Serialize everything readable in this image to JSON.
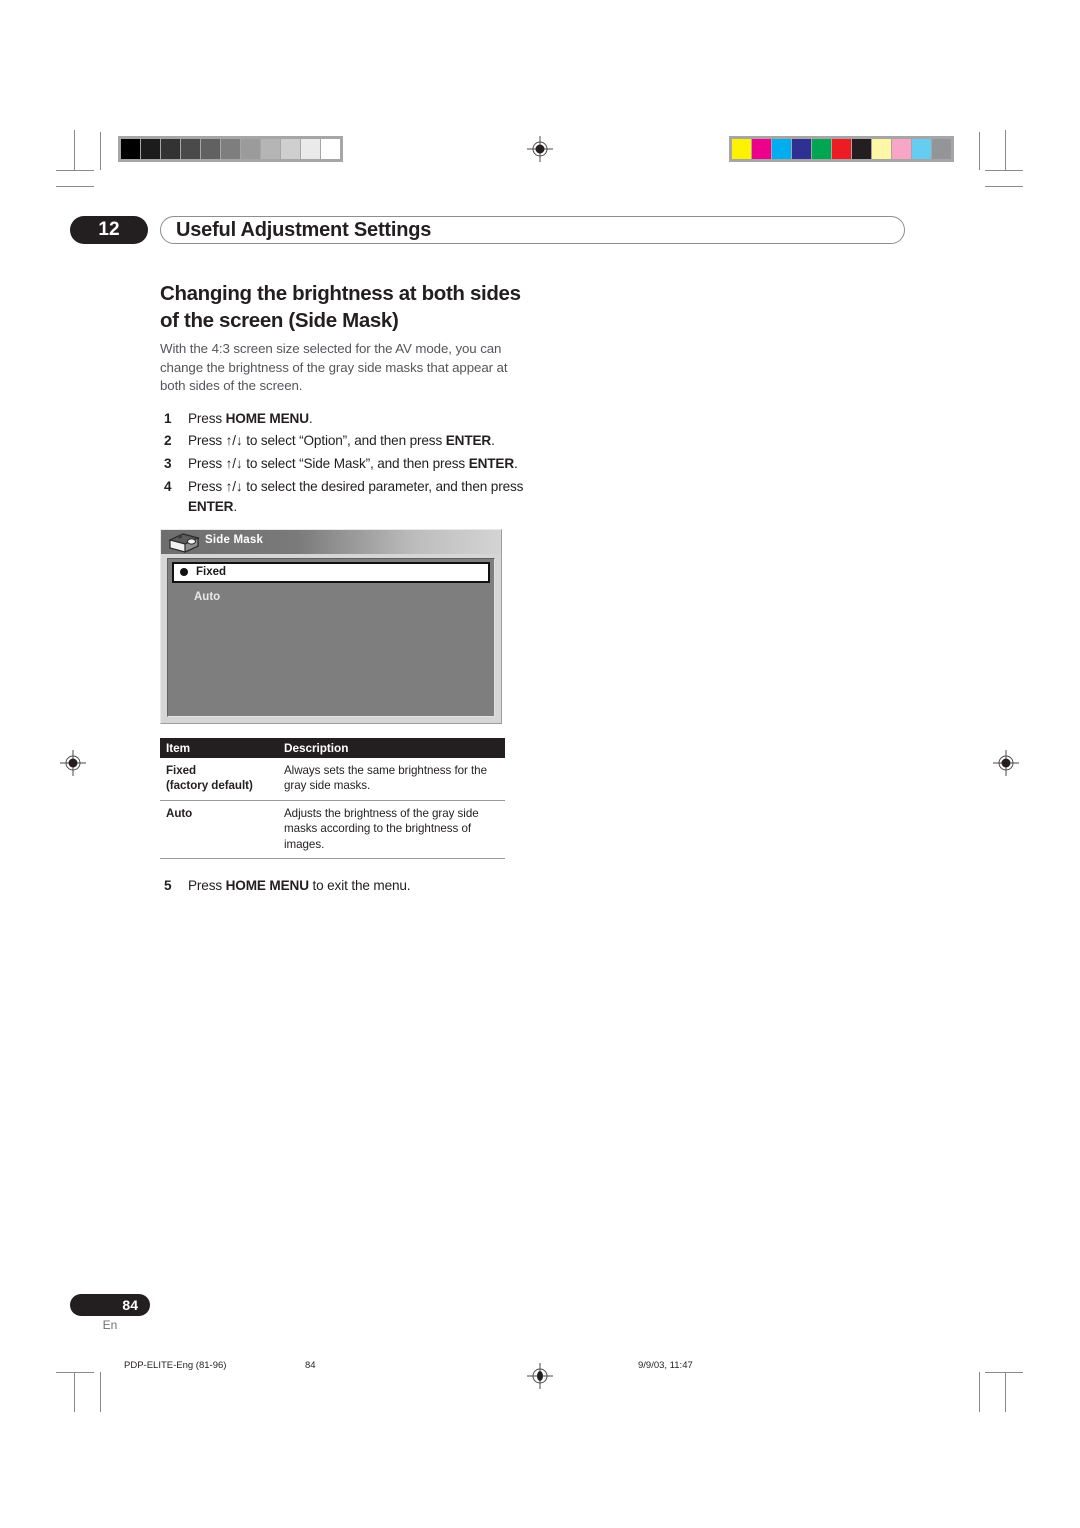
{
  "document": {
    "chapter_number": "12",
    "chapter_title": "Useful Adjustment Settings",
    "page_number": "84",
    "language_code": "En"
  },
  "section": {
    "title": "Changing the brightness at both sides of the screen (Side Mask)",
    "intro": "With the 4:3 screen size selected for the AV mode, you can change the brightness of the gray side masks that appear at both sides of the screen."
  },
  "steps": [
    {
      "num": "1",
      "text_html": "Press <b>HOME MENU</b>."
    },
    {
      "num": "2",
      "text_html": "Press <b>↑</b>/<b>↓</b> to select “Option”, and then press <b>ENTER</b>."
    },
    {
      "num": "3",
      "text_html": "Press <b>↑</b>/<b>↓</b> to select “Side Mask”, and then press <b>ENTER</b>."
    },
    {
      "num": "4",
      "text_html": "Press <b>↑</b>/<b>↓</b> to select the desired parameter, and then press <b>ENTER</b>."
    }
  ],
  "final_step": {
    "num": "5",
    "text_html": "Press <b>HOME MENU</b> to exit the menu."
  },
  "osd": {
    "icon_name": "side-mask-projector-icon",
    "title": "Side Mask",
    "items": [
      {
        "label": "Fixed",
        "selected": true
      },
      {
        "label": "Auto",
        "selected": false
      }
    ]
  },
  "table": {
    "headers": [
      "Item",
      "Description"
    ],
    "rows": [
      {
        "item": "Fixed",
        "item_sub": "(factory default)",
        "description": "Always sets the same brightness for the gray side masks."
      },
      {
        "item": "Auto",
        "item_sub": "",
        "description": "Adjusts the brightness of the gray side masks according to the brightness of images."
      }
    ]
  },
  "print_marks": {
    "gray_wedge": [
      "#000000",
      "#1c1c1c",
      "#333333",
      "#4a4a4a",
      "#616161",
      "#7e7e7e",
      "#9b9b9b",
      "#b5b5b5",
      "#cfcfcf",
      "#eaeaea",
      "#ffffff"
    ],
    "color_bar": [
      "#fff200",
      "#ec008c",
      "#00aeef",
      "#2e3192",
      "#00a651",
      "#ed1c24",
      "#231f20",
      "#fff7a8",
      "#f7a6c8",
      "#65cdf2",
      "#939598"
    ]
  },
  "footer_slug": {
    "file": "PDP-ELITE-Eng (81-96)",
    "page": "84",
    "date": "9/9/03, 11:47"
  }
}
